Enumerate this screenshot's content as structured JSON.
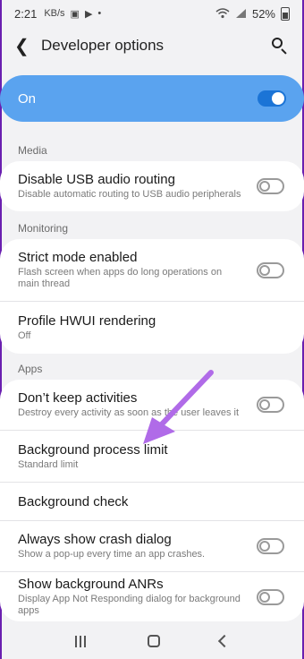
{
  "status": {
    "time": "2:21",
    "battery": "52%",
    "icons": [
      "KB/s",
      "▣",
      "▶",
      "•"
    ]
  },
  "appbar": {
    "title": "Developer options"
  },
  "master": {
    "label": "On",
    "state": true
  },
  "sections": {
    "media": "Media",
    "monitoring": "Monitoring",
    "apps": "Apps"
  },
  "rows": {
    "usb": {
      "title": "Disable USB audio routing",
      "sub": "Disable automatic routing to USB audio peripherals"
    },
    "strict": {
      "title": "Strict mode enabled",
      "sub": "Flash screen when apps do long operations on main thread"
    },
    "hwui": {
      "title": "Profile HWUI rendering",
      "sub": "Off"
    },
    "dka": {
      "title": "Don’t keep activities",
      "sub": "Destroy every activity as soon as the user leaves it"
    },
    "bpl": {
      "title": "Background process limit",
      "sub": "Standard limit"
    },
    "bgcheck": {
      "title": "Background check"
    },
    "crash": {
      "title": "Always show crash dialog",
      "sub": "Show a pop-up every time an app crashes."
    },
    "anr": {
      "title": "Show background ANRs",
      "sub": "Display App Not Responding dialog for background apps"
    }
  },
  "colors": {
    "accent": "#5aa3ef",
    "toggle_on": "#1b74d6",
    "annotation_arrow": "#b06be8"
  }
}
